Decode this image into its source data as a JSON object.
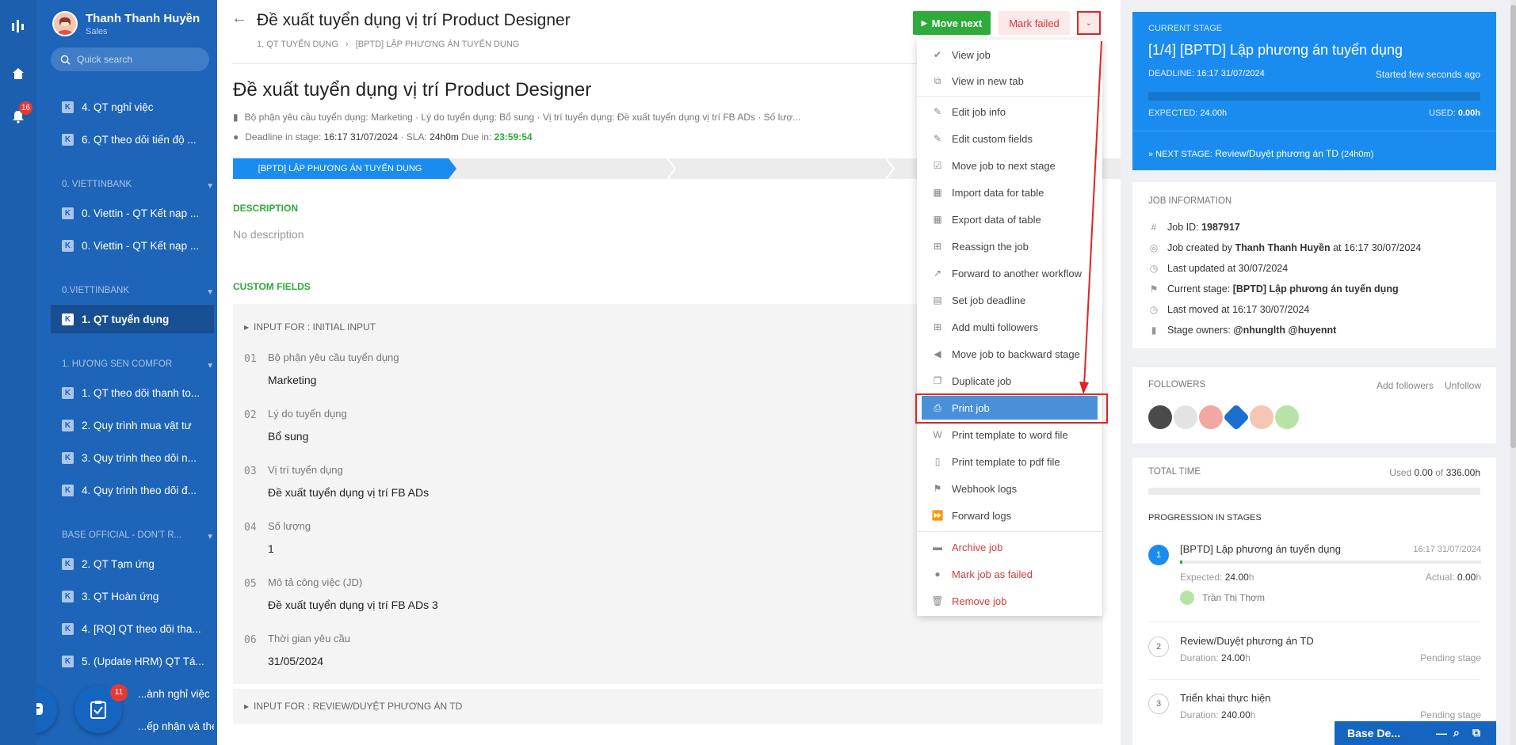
{
  "rail": {
    "notif_count": "16"
  },
  "user": {
    "name": "Thanh Thanh Huyền",
    "role": "Sales"
  },
  "search": {
    "placeholder": "Quick search"
  },
  "sidebar": {
    "items": [
      {
        "label": "4. QT nghỉ việc"
      },
      {
        "label": "6. QT theo dõi tiến độ ..."
      },
      {
        "label": "0. Viettin - QT Kết nạp ..."
      },
      {
        "label": "0. Viettin - QT Kết nạp ..."
      },
      {
        "label": "1. QT tuyển dụng"
      },
      {
        "label": "1. QT theo dõi thanh to..."
      },
      {
        "label": "2. Quy trình mua vật tư"
      },
      {
        "label": "3. Quy trình theo dõi n..."
      },
      {
        "label": "4. Quy trình theo dõi đ..."
      },
      {
        "label": "2. QT Tạm ứng"
      },
      {
        "label": "3. QT Hoàn ứng"
      },
      {
        "label": "4. [RQ] QT theo dõi tha..."
      },
      {
        "label": "5. (Update HRM) QT Tá..."
      },
      {
        "label": "...ành nghỉ việc"
      },
      {
        "label": "...ếp nhận và theo d..."
      }
    ],
    "groups": [
      "0. VIETTINBANK",
      "0.VIETTINBANK",
      "1. HƯƠNG SEN COMFOR",
      "BASE OFFICIAL - DON'T R..."
    ],
    "tasks_badge": "11"
  },
  "header": {
    "title": "Đề xuất tuyển dụng vị trí Product Designer",
    "crumb1": "1. QT TUYỂN DỤNG",
    "crumb2": "[BPTD] LẬP PHƯƠNG ÁN TUYỂN DỤNG",
    "move_next": "Move next",
    "mark_failed": "Mark failed"
  },
  "job": {
    "title": "Đề xuất tuyển dụng vị trí Product Designer",
    "meta": "Bộ phận yêu cầu tuyển dụng: Marketing · Lý do tuyển dụng: Bổ sung · Vị trí tuyển dụng: Đề xuất tuyển dụng vị trí FB ADs · Số lượ...",
    "deadline_label": "Deadline in stage:",
    "deadline": "16:17 31/07/2024",
    "sla_label": "· SLA:",
    "sla": "24h0m",
    "due_label": "Due in:",
    "due": "23:59:54"
  },
  "stages": {
    "current": "[BPTD] LẬP PHƯƠNG ÁN TUYỂN DỤNG"
  },
  "description": {
    "label": "DESCRIPTION",
    "empty": "No description"
  },
  "custom_fields": {
    "label": "CUSTOM FIELDS",
    "group1": "INPUT FOR : INITIAL INPUT",
    "group2": "INPUT FOR : REVIEW/DUYỆT PHƯƠNG ÁN TD",
    "fields": [
      {
        "num": "01",
        "label": "Bộ phận yêu cầu tuyển dụng",
        "value": "Marketing"
      },
      {
        "num": "02",
        "label": "Lý do tuyển dụng",
        "value": "Bổ sung"
      },
      {
        "num": "03",
        "label": "Vị trí tuyển dụng",
        "value": "Đề xuất tuyển dụng vị trí FB ADs"
      },
      {
        "num": "04",
        "label": "Số lượng",
        "value": "1"
      },
      {
        "num": "05",
        "label": "Mô tả công việc (JD)",
        "value": "Đề xuất tuyển dụng vị trí FB ADs 3"
      },
      {
        "num": "06",
        "label": "Thời gian yêu cầu",
        "value": "31/05/2024"
      }
    ]
  },
  "menu": {
    "items": [
      {
        "label": "View job",
        "icon": "check-icon"
      },
      {
        "label": "View in new tab",
        "icon": "external-link-icon"
      },
      {
        "label": "Edit job info",
        "icon": "edit-icon"
      },
      {
        "label": "Edit custom fields",
        "icon": "edit-icon"
      },
      {
        "label": "Move job to next stage",
        "icon": "checkbox-icon"
      },
      {
        "label": "Import data for table",
        "icon": "table-icon"
      },
      {
        "label": "Export data of table",
        "icon": "table-icon"
      },
      {
        "label": "Reassign the job",
        "icon": "plus-square-icon"
      },
      {
        "label": "Forward to another workflow",
        "icon": "forward-icon"
      },
      {
        "label": "Set job deadline",
        "icon": "calendar-icon"
      },
      {
        "label": "Add multi followers",
        "icon": "plus-square-icon"
      },
      {
        "label": "Move job to backward stage",
        "icon": "back-circle-icon"
      },
      {
        "label": "Duplicate job",
        "icon": "duplicate-icon"
      },
      {
        "label": "Print job",
        "icon": "printer-icon"
      },
      {
        "label": "Print template to word file",
        "icon": "word-file-icon"
      },
      {
        "label": "Print template to pdf file",
        "icon": "pdf-file-icon"
      },
      {
        "label": "Webhook logs",
        "icon": "flag-icon"
      },
      {
        "label": "Forward logs",
        "icon": "fast-forward-icon"
      },
      {
        "label": "Archive job",
        "icon": "archive-icon"
      },
      {
        "label": "Mark job as failed",
        "icon": "alert-icon"
      },
      {
        "label": "Remove job",
        "icon": "trash-icon"
      }
    ]
  },
  "current_stage": {
    "label": "CURRENT STAGE",
    "name": "[1/4] [BPTD] Lập phương án tuyển dụng",
    "deadline_label": "DEADLINE:",
    "deadline": "16:17 31/07/2024",
    "started": "Started few seconds ago",
    "expected_label": "EXPECTED:",
    "expected": "24.00h",
    "used_label": "USED:",
    "used": "0.00h",
    "next_label": "» NEXT STAGE:",
    "next": "Review/Duyệt phương án TD",
    "next_dur": "(24h0m)"
  },
  "job_info": {
    "label": "JOB INFORMATION",
    "id_label": "Job ID:",
    "id": "1987917",
    "created_pre": "Job created by",
    "created_by": "Thanh Thanh Huyền",
    "created_at": "at 16:17 30/07/2024",
    "updated": "Last updated at 30/07/2024",
    "stage_label": "Current stage:",
    "stage": "[BPTD] Lập phương án tuyển dụng",
    "moved": "Last moved at 16:17 30/07/2024",
    "owners_label": "Stage owners:",
    "owners": "@nhunglth @huyennt"
  },
  "followers": {
    "label": "FOLLOWERS",
    "add": "Add followers",
    "unfollow": "Unfollow"
  },
  "total_time": {
    "label": "TOTAL TIME",
    "used_pre": "Used",
    "used": "0.00",
    "of": "of",
    "total": "336.00h",
    "prog_label": "PROGRESSION IN STAGES",
    "stages": [
      {
        "num": "1",
        "name": "[BPTD] Lập phương án tuyển dụng",
        "time": "16:17 31/07/2024",
        "exp_label": "Expected:",
        "exp": "24.00",
        "exp_unit": "h",
        "act_label": "Actual:",
        "act": "0.00",
        "act_unit": "h",
        "person": "Trần Thị Thơm"
      },
      {
        "num": "2",
        "name": "Review/Duyệt phương án TD",
        "dur_label": "Duration:",
        "dur": "24.00",
        "dur_unit": "h",
        "status": "Pending stage"
      },
      {
        "num": "3",
        "name": "Triển khai thực hiện",
        "dur_label": "Duration:",
        "dur": "240.00",
        "dur_unit": "h",
        "status": "Pending stage"
      }
    ]
  },
  "chat": {
    "label": "Base De..."
  },
  "colors": {
    "accent": "#1a8cf0",
    "success": "#2eab3a",
    "danger": "#d23b3b",
    "sidebar": "#1e64b8"
  }
}
